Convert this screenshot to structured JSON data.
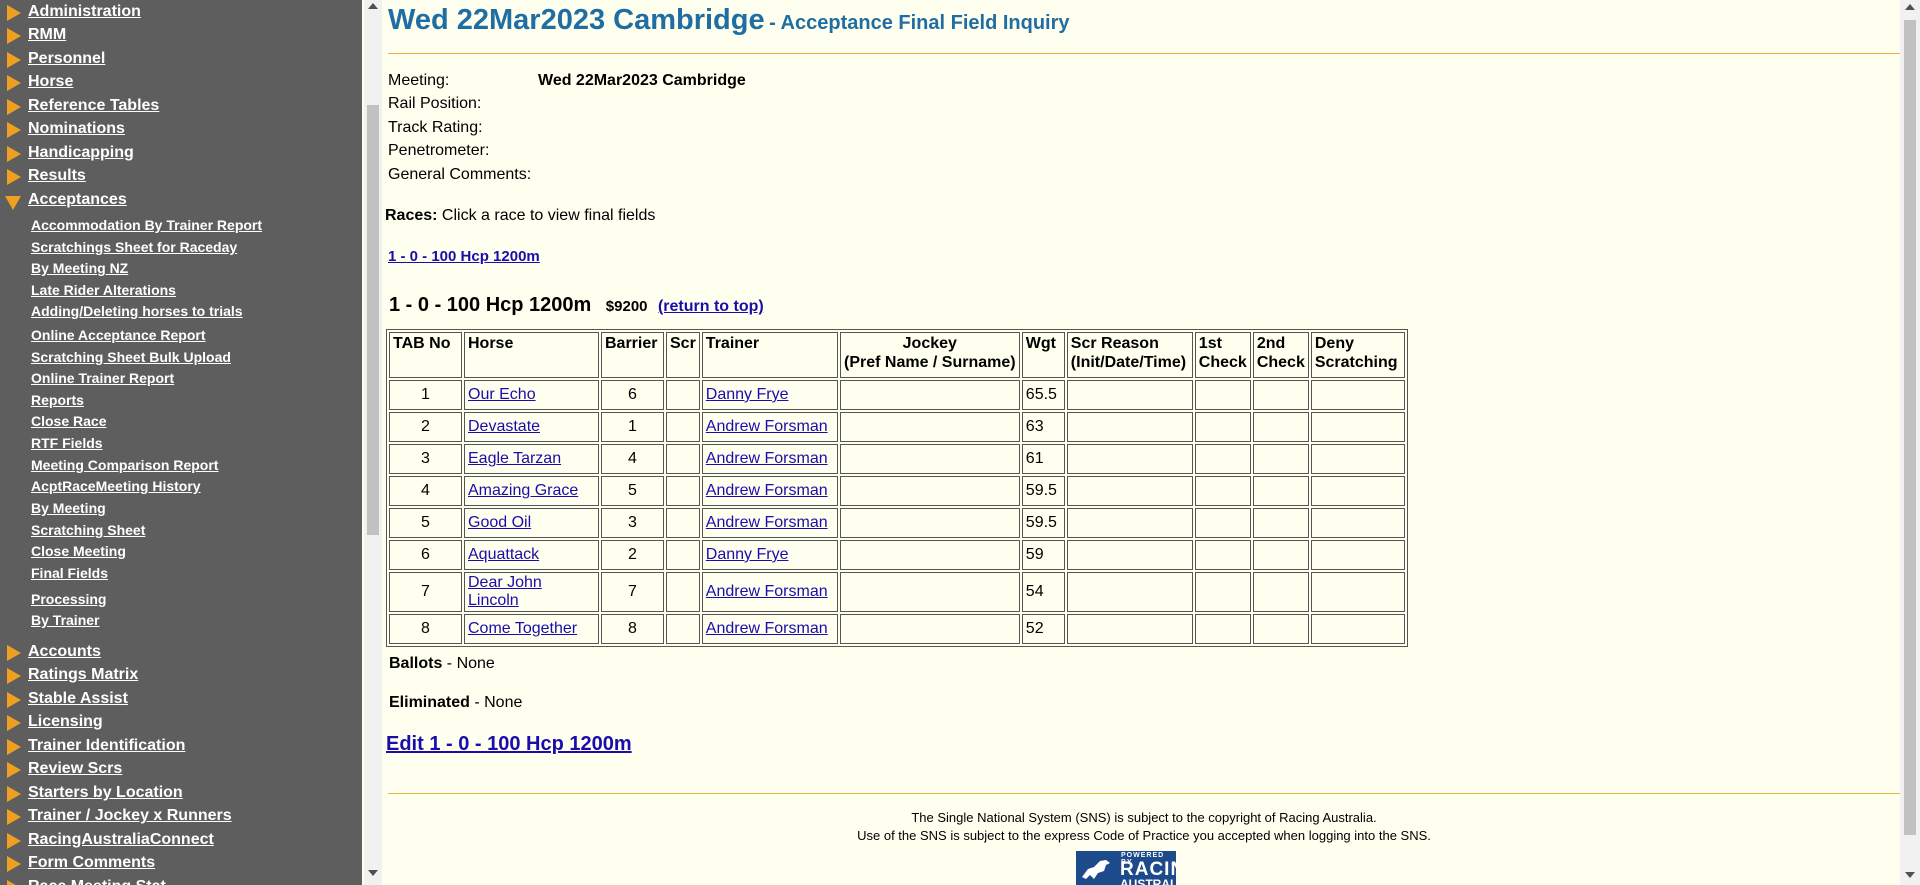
{
  "sidebar": {
    "groups_top": [
      {
        "label": "Administration"
      },
      {
        "label": "RMM"
      },
      {
        "label": "Personnel"
      },
      {
        "label": "Horse"
      },
      {
        "label": "Reference Tables"
      },
      {
        "label": "Nominations"
      },
      {
        "label": "Handicapping"
      },
      {
        "label": "Results"
      }
    ],
    "open_group": {
      "label": "Acceptances"
    },
    "sub_items": [
      {
        "label": "Accommodation By Trainer Report"
      },
      {
        "label": "Scratchings Sheet for Raceday"
      },
      {
        "label": "By Meeting NZ"
      },
      {
        "label": "Late Rider Alterations"
      },
      {
        "label": "Adding/Deleting horses to trials"
      },
      {
        "label": "Online Acceptance Report"
      },
      {
        "label": "Scratching Sheet Bulk Upload"
      },
      {
        "label": "Online Trainer Report"
      },
      {
        "label": "Reports"
      },
      {
        "label": "Close Race"
      },
      {
        "label": "RTF Fields"
      },
      {
        "label": "Meeting Comparison Report"
      },
      {
        "label": "AcptRaceMeeting History"
      },
      {
        "label": "By Meeting"
      },
      {
        "label": "Scratching Sheet"
      },
      {
        "label": "Close Meeting"
      },
      {
        "label": "Final Fields"
      },
      {
        "label": "Processing"
      },
      {
        "label": "By Trainer"
      }
    ],
    "groups_bottom": [
      {
        "label": "Accounts"
      },
      {
        "label": "Ratings Matrix"
      },
      {
        "label": "Stable Assist"
      },
      {
        "label": "Licensing"
      },
      {
        "label": "Trainer Identification"
      },
      {
        "label": "Review Scrs"
      },
      {
        "label": "Starters by Location"
      },
      {
        "label": "Trainer / Jockey x Runners"
      },
      {
        "label": "RacingAustraliaConnect"
      },
      {
        "label": "Form Comments"
      },
      {
        "label": "Race Meeting Stat"
      }
    ]
  },
  "page": {
    "title": "Wed 22Mar2023 Cambridge",
    "subtitle": "- Acceptance Final Field Inquiry"
  },
  "info": {
    "meeting_label": "Meeting:",
    "meeting_value": "Wed 22Mar2023 Cambridge",
    "rail_label": "Rail Position:",
    "track_label": "Track Rating:",
    "pen_label": "Penetrometer:",
    "comments_label": "General Comments:"
  },
  "races": {
    "label": "Races:",
    "instruction": " Click a race to view final fields",
    "link": "1 - 0 - 100 Hcp 1200m"
  },
  "race": {
    "name": "1 - 0 - 100 Hcp 1200m",
    "prize": "$9200",
    "return_top": "(return to top)",
    "headers": [
      "TAB No",
      "Horse",
      "Barrier",
      "Scr",
      "Trainer",
      "Jockey\n(Pref Name / Surname)",
      "Wgt",
      "Scr Reason\n(Init/Date/Time)",
      "1st\nCheck",
      "2nd\nCheck",
      "Deny\nScratching"
    ],
    "rows": [
      {
        "tab": "1",
        "horse": "Our Echo",
        "barrier": "6",
        "trainer": "Danny Frye",
        "wgt": "65.5"
      },
      {
        "tab": "2",
        "horse": "Devastate",
        "barrier": "1",
        "trainer": "Andrew Forsman",
        "wgt": "63"
      },
      {
        "tab": "3",
        "horse": "Eagle Tarzan",
        "barrier": "4",
        "trainer": "Andrew Forsman",
        "wgt": "61"
      },
      {
        "tab": "4",
        "horse": "Amazing Grace",
        "barrier": "5",
        "trainer": "Andrew Forsman",
        "wgt": "59.5"
      },
      {
        "tab": "5",
        "horse": "Good Oil",
        "barrier": "3",
        "trainer": "Andrew Forsman",
        "wgt": "59.5"
      },
      {
        "tab": "6",
        "horse": "Aquattack",
        "barrier": "2",
        "trainer": "Danny Frye",
        "wgt": "59"
      },
      {
        "tab": "7",
        "horse": "Dear John Lincoln",
        "barrier": "7",
        "trainer": "Andrew Forsman",
        "wgt": "54"
      },
      {
        "tab": "8",
        "horse": "Come Together",
        "barrier": "8",
        "trainer": "Andrew Forsman",
        "wgt": "52"
      }
    ],
    "ballots_label": "Ballots",
    "ballots_value": " - None",
    "eliminated_label": "Eliminated",
    "eliminated_value": " - None",
    "edit_link": " Edit 1 - 0 - 100 Hcp 1200m"
  },
  "footer": {
    "line1": "The Single National System (SNS) is subject to the copyright of Racing Australia.",
    "line2": "Use of the SNS is subject to the express Code of Practice you accepted when logging into the SNS.",
    "logo_powered": "POWERED BY",
    "logo_racing": "RACING",
    "logo_australia": "AUSTRALIA"
  },
  "colors": {
    "sidebar_bg": "#5e5e5e",
    "page_bg": "#fffff0",
    "title": "#1f6ea3",
    "triangle": "#f0a020",
    "link": "#1a0dab",
    "rule": "#f0b040"
  }
}
